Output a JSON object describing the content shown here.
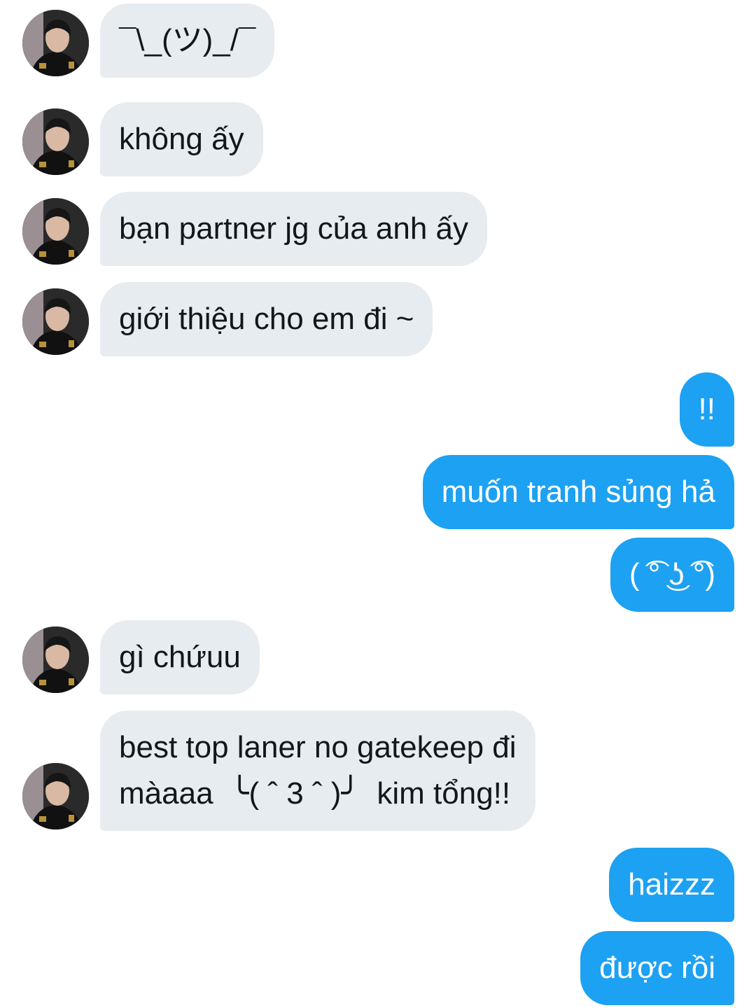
{
  "conversation": {
    "messages": [
      {
        "direction": "in",
        "text": "¯\\_(ツ)_/¯"
      },
      {
        "direction": "in",
        "text": "không ấy"
      },
      {
        "direction": "in",
        "text": "bạn partner jg của anh ấy"
      },
      {
        "direction": "in",
        "text": "giới thiệu cho em đi ~"
      },
      {
        "direction": "out",
        "text": "!!"
      },
      {
        "direction": "out",
        "text": "muốn tranh sủng hả"
      },
      {
        "direction": "out",
        "text": "( ͡° ͜ʖ ͡°)"
      },
      {
        "direction": "in",
        "text": "gì chứuu"
      },
      {
        "direction": "in",
        "text": "best top laner no gatekeep đi\nmàaaa  ╰( ˆ 3 ˆ )╯  kim tổng!!"
      },
      {
        "direction": "out",
        "text": "haizzz"
      },
      {
        "direction": "out",
        "text": "được rồi"
      }
    ]
  },
  "colors": {
    "incoming_bubble": "#e7ecf0",
    "outgoing_bubble": "#1da1f2",
    "incoming_text": "#14171a",
    "outgoing_text": "#ffffff"
  },
  "icons": {
    "avatar": "user-avatar-photo"
  }
}
